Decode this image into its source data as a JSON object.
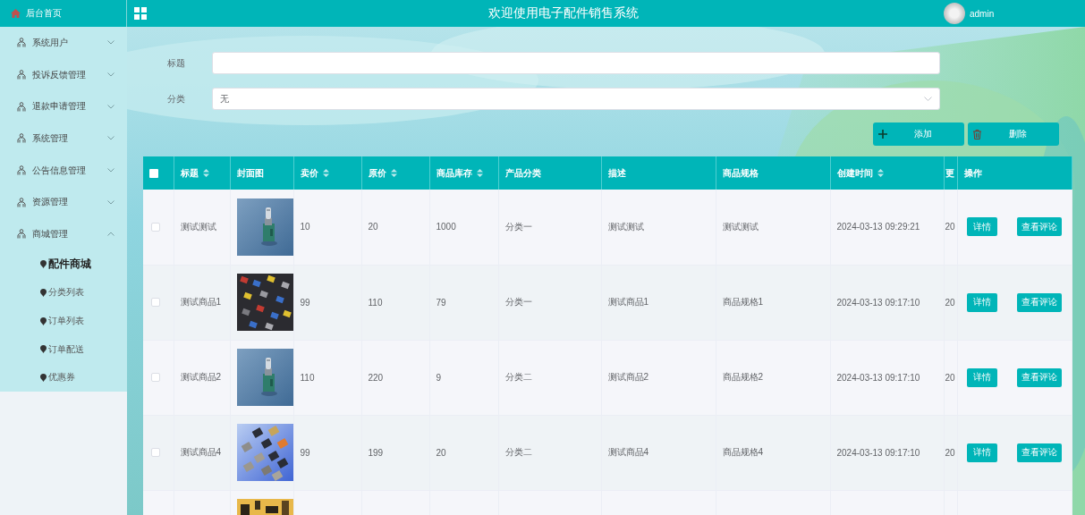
{
  "header": {
    "title": "欢迎使用电子配件销售系统",
    "user": "admin"
  },
  "sidebar": {
    "home": "后台首页",
    "items": [
      {
        "label": "系统用户",
        "expanded": false
      },
      {
        "label": "投诉反馈管理",
        "expanded": false
      },
      {
        "label": "退款申请管理",
        "expanded": false
      },
      {
        "label": "系统管理",
        "expanded": false
      },
      {
        "label": "公告信息管理",
        "expanded": false
      },
      {
        "label": "资源管理",
        "expanded": false
      },
      {
        "label": "商城管理",
        "expanded": true,
        "children": [
          {
            "label": "配件商城",
            "selected": true
          },
          {
            "label": "分类列表",
            "selected": false
          },
          {
            "label": "订单列表",
            "selected": false
          },
          {
            "label": "订单配送",
            "selected": false
          },
          {
            "label": "优惠券",
            "selected": false
          }
        ]
      }
    ]
  },
  "filters": [
    {
      "label": "标题",
      "kind": "text"
    },
    {
      "label": "分类",
      "kind": "select",
      "value": "无"
    }
  ],
  "buttons": [
    {
      "label": "添加",
      "kind": "add"
    },
    {
      "label": "删除",
      "kind": "delete"
    }
  ],
  "table": {
    "select_all": {
      "checked": false
    },
    "columns": [
      {
        "label": "标题",
        "sortable": true
      },
      {
        "label": "封面图",
        "sortable": false
      },
      {
        "label": "卖价",
        "sortable": true
      },
      {
        "label": "原价",
        "sortable": true
      },
      {
        "label": "商品库存",
        "sortable": true
      },
      {
        "label": "产品分类",
        "sortable": false
      },
      {
        "label": "描述",
        "sortable": false
      },
      {
        "label": "商品规格",
        "sortable": false
      },
      {
        "label": "创建时间",
        "sortable": true
      },
      {
        "label": "更",
        "sortable": false
      },
      {
        "label": "操作",
        "sortable": false
      }
    ],
    "rows": [
      {
        "checked": false,
        "title": "测试测试",
        "cover": {
          "kind": "switch"
        },
        "cells": [
          "10",
          "20",
          "1000",
          "分类一",
          "测试测试",
          "测试测试",
          "2024-03-13 09:29:21",
          "20"
        ],
        "actions": [
          "详情",
          "查看评论"
        ]
      },
      {
        "checked": false,
        "title": "测试商品1",
        "cover": {
          "kind": "parts"
        },
        "cells": [
          "99",
          "110",
          "79",
          "分类一",
          "测试商品1",
          "商品规格1",
          "2024-03-13 09:17:10",
          "20"
        ],
        "actions": [
          "详情",
          "查看评论"
        ]
      },
      {
        "checked": false,
        "title": "测试商品2",
        "cover": {
          "kind": "switch"
        },
        "cells": [
          "110",
          "220",
          "9",
          "分类二",
          "测试商品2",
          "商品规格2",
          "2024-03-13 09:17:10",
          "20"
        ],
        "actions": [
          "详情",
          "查看评论"
        ]
      },
      {
        "checked": false,
        "title": "测试商品4",
        "cover": {
          "kind": "chips"
        },
        "cells": [
          "99",
          "199",
          "20",
          "分类二",
          "测试商品4",
          "商品规格4",
          "2024-03-13 09:17:10",
          "20"
        ],
        "actions": [
          "详情",
          "查看评论"
        ]
      },
      {
        "cover": {
          "kind": "board"
        }
      }
    ]
  }
}
